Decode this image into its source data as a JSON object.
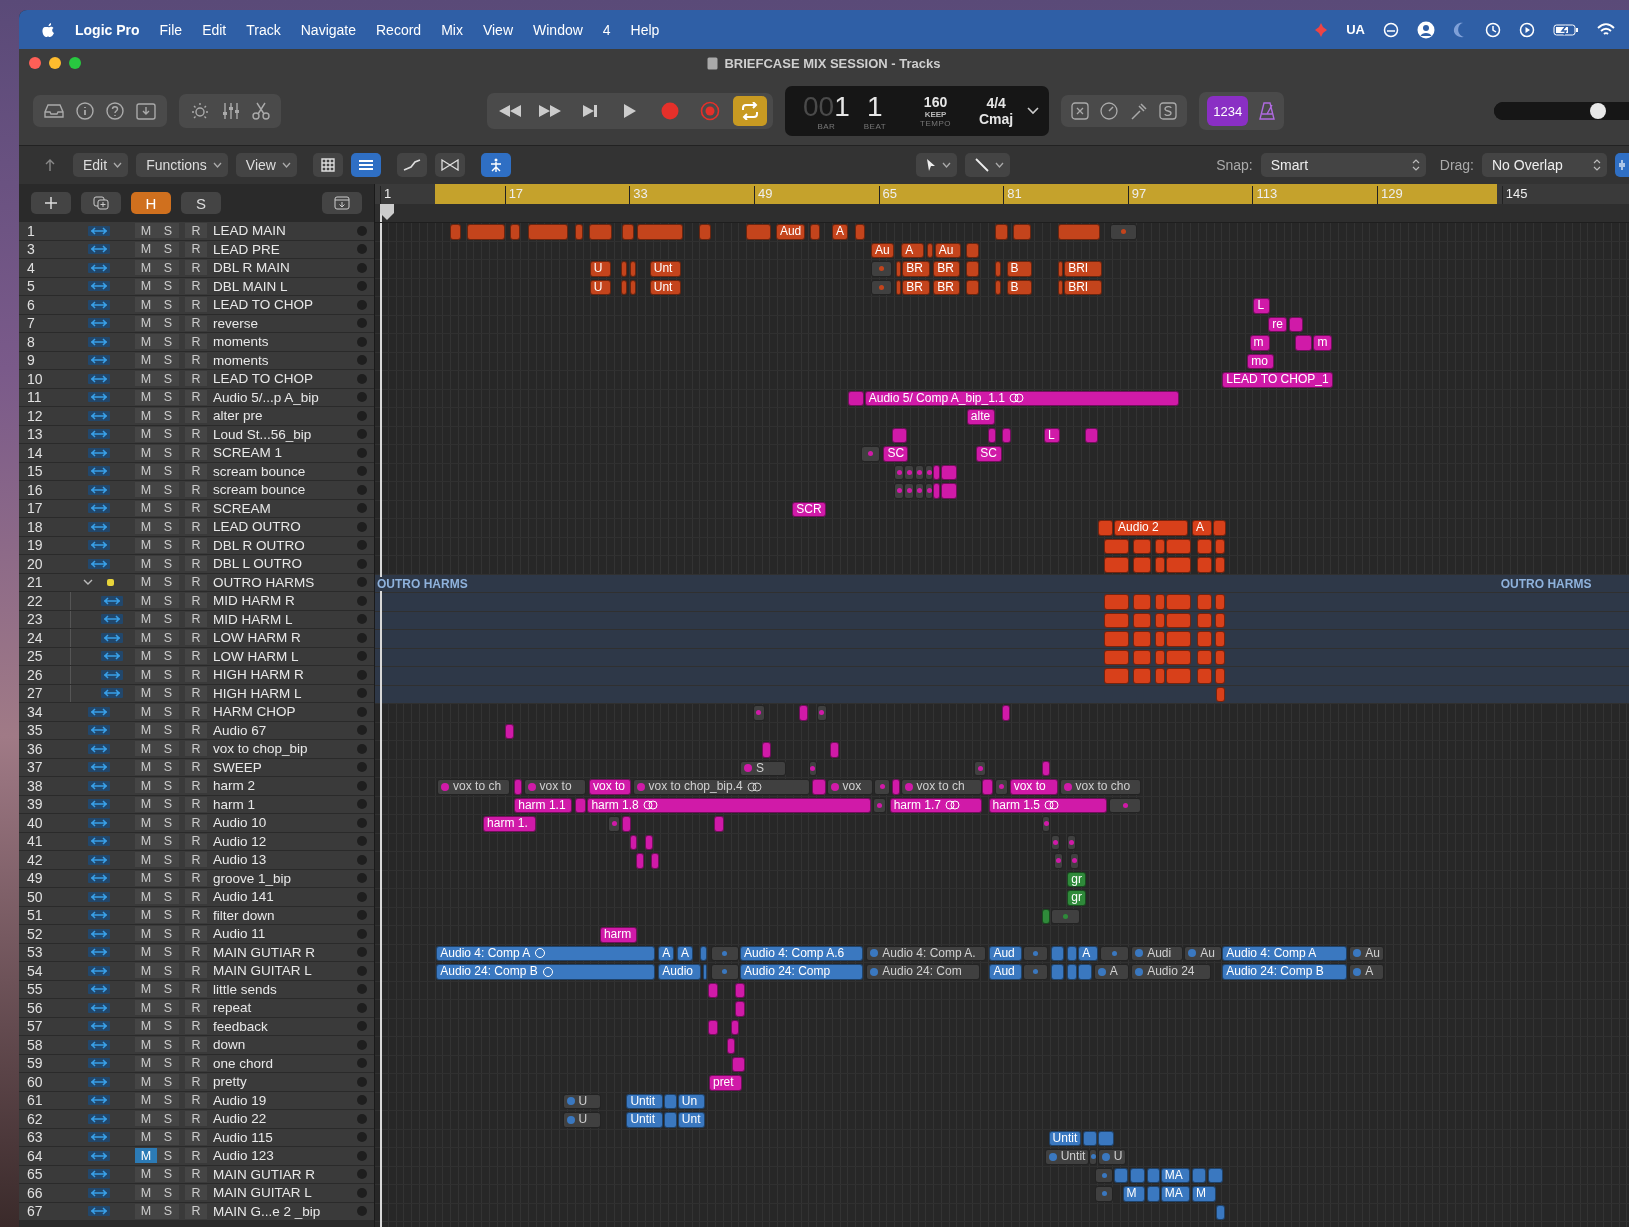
{
  "menu_bar": {
    "app_name": "Logic Pro",
    "items": [
      "File",
      "Edit",
      "Track",
      "Navigate",
      "Record",
      "Mix",
      "View",
      "Window",
      "4",
      "Help"
    ],
    "status_text": "UA"
  },
  "window": {
    "title": "BRIEFCASE MIX SESSION - Tracks"
  },
  "control_bar": {
    "cycle_on": true,
    "lcd": {
      "bar_prefix": "00",
      "bar": "1",
      "beat": "1",
      "bar_label": "BAR",
      "beat_label": "BEAT",
      "tempo": "160",
      "tempo_mode": "KEEP",
      "tempo_label": "TEMPO",
      "time_signature": "4/4",
      "key": "Cmaj"
    },
    "count_in": "1234",
    "master_volume": {
      "level": 0.72
    }
  },
  "tracks_toolbar": {
    "menus": [
      "Edit",
      "Functions",
      "View"
    ],
    "snap_label": "Snap:",
    "snap_value": "Smart",
    "drag_label": "Drag:",
    "drag_value": "No Overlap"
  },
  "track_header": {
    "buttons": [
      {
        "label": "H",
        "selected": true
      },
      {
        "label": "S",
        "selected": false
      }
    ]
  },
  "ruler": {
    "bars": [
      "1",
      "17",
      "33",
      "49",
      "65",
      "81",
      "97",
      "113",
      "129",
      "145"
    ]
  },
  "tracks": [
    {
      "number": "1",
      "name": "LEAD MAIN",
      "mute_label": "M",
      "mute": false,
      "solo_label": "S",
      "record_label": "R",
      "color": "#c4441c",
      "regions": [
        {
          "active": true
        },
        {
          "active": true
        },
        {
          "active": true
        },
        {
          "active": true
        },
        {
          "active": true
        },
        {
          "active": true
        },
        {
          "active": true
        },
        {
          "active": true
        },
        {
          "active": true
        },
        {
          "active": true
        },
        {
          "label": "Aud",
          "active": true
        },
        {
          "active": true
        },
        {
          "label": "A",
          "active": true
        },
        {
          "active": true
        },
        {
          "active": true
        },
        {
          "active": true
        },
        {
          "active": true
        },
        {
          "active": false
        }
      ]
    },
    {
      "number": "3",
      "name": "LEAD PRE",
      "mute_label": "M",
      "mute": false,
      "solo_label": "S",
      "record_label": "R",
      "color": "#c4441c",
      "regions": [
        {
          "label": "Au",
          "active": true
        },
        {
          "label": "A",
          "active": true
        },
        {
          "active": true
        },
        {
          "label": "Au",
          "active": true
        },
        {
          "active": true
        }
      ]
    },
    {
      "number": "4",
      "name": "DBL R MAIN",
      "mute_label": "M",
      "mute": false,
      "solo_label": "S",
      "record_label": "R",
      "color": "#c4441c",
      "regions": [
        {
          "label": "U",
          "active": true
        },
        {
          "active": true
        },
        {
          "active": true
        },
        {
          "label": "Unt",
          "active": true
        },
        {
          "active": false
        },
        {
          "active": true
        },
        {
          "label": "BR",
          "active": true
        },
        {
          "label": "BR",
          "active": true
        },
        {
          "active": true
        },
        {
          "active": true
        },
        {
          "label": "B",
          "active": true
        },
        {
          "active": true
        },
        {
          "label": "BRI",
          "active": true
        }
      ]
    },
    {
      "number": "5",
      "name": "DBL MAIN L",
      "mute_label": "M",
      "mute": false,
      "solo_label": "S",
      "record_label": "R",
      "color": "#c4441c",
      "regions": [
        {
          "label": "U",
          "active": true
        },
        {
          "active": true
        },
        {
          "active": true
        },
        {
          "label": "Unt",
          "active": true
        },
        {
          "active": false
        },
        {
          "active": true
        },
        {
          "label": "BR",
          "active": true
        },
        {
          "label": "BR",
          "active": true
        },
        {
          "active": true
        },
        {
          "active": true
        },
        {
          "label": "B",
          "active": true
        },
        {
          "active": true
        },
        {
          "label": "BRI",
          "active": true
        }
      ]
    },
    {
      "number": "6",
      "name": "LEAD TO CHOP",
      "mute_label": "M",
      "mute": false,
      "solo_label": "S",
      "record_label": "R",
      "color": "#d01aa8",
      "regions": [
        {
          "label": "L",
          "active": true
        }
      ]
    },
    {
      "number": "7",
      "name": "reverse",
      "mute_label": "M",
      "mute": false,
      "solo_label": "S",
      "record_label": "R",
      "color": "#d01aa8",
      "regions": [
        {
          "label": "re",
          "active": true
        },
        {
          "active": true
        }
      ]
    },
    {
      "number": "8",
      "name": "moments",
      "mute_label": "M",
      "mute": false,
      "solo_label": "S",
      "record_label": "R",
      "color": "#d01aa8",
      "regions": [
        {
          "label": "m",
          "active": true
        },
        {
          "active": true
        },
        {
          "label": "m",
          "active": true
        }
      ]
    },
    {
      "number": "9",
      "name": "moments",
      "mute_label": "M",
      "mute": false,
      "solo_label": "S",
      "record_label": "R",
      "color": "#d01aa8",
      "regions": [
        {
          "label": "mo",
          "active": true
        }
      ]
    },
    {
      "number": "10",
      "name": "LEAD TO CHOP",
      "mute_label": "M",
      "mute": false,
      "solo_label": "S",
      "record_label": "R",
      "color": "#d01aa8",
      "regions": [
        {
          "label": "LEAD TO CHOP_1",
          "active": true
        }
      ]
    },
    {
      "number": "11",
      "name": "Audio 5/...p A_bip",
      "mute_label": "M",
      "mute": false,
      "solo_label": "S",
      "record_label": "R",
      "color": "#d01aa8",
      "regions": [
        {
          "active": true
        },
        {
          "label": "Audio 5/ Comp A_bip_1.1",
          "kind": "comp",
          "active": true
        }
      ]
    },
    {
      "number": "12",
      "name": "alter pre",
      "mute_label": "M",
      "mute": false,
      "solo_label": "S",
      "record_label": "R",
      "color": "#d01aa8",
      "regions": [
        {
          "label": "alte",
          "active": true
        }
      ]
    },
    {
      "number": "13",
      "name": "Loud St...56_bip",
      "mute_label": "M",
      "mute": false,
      "solo_label": "S",
      "record_label": "R",
      "color": "#d01aa8",
      "regions": [
        {
          "active": true
        },
        {
          "active": true
        },
        {
          "active": true
        },
        {
          "label": "L",
          "active": true
        },
        {
          "active": true
        }
      ]
    },
    {
      "number": "14",
      "name": "SCREAM 1",
      "mute_label": "M",
      "mute": false,
      "solo_label": "S",
      "record_label": "R",
      "color": "#d01aa8",
      "regions": [
        {
          "active": false
        },
        {
          "label": "SC",
          "active": true
        },
        {
          "label": "SC",
          "active": true
        }
      ]
    },
    {
      "number": "15",
      "name": "scream bounce",
      "mute_label": "M",
      "mute": false,
      "solo_label": "S",
      "record_label": "R",
      "color": "#d01aa8",
      "regions": [
        {
          "active": false
        },
        {
          "active": false
        },
        {
          "active": false
        },
        {
          "active": false
        },
        {
          "active": true
        },
        {
          "active": true
        }
      ]
    },
    {
      "number": "16",
      "name": "scream bounce",
      "mute_label": "M",
      "mute": false,
      "solo_label": "S",
      "record_label": "R",
      "color": "#d01aa8",
      "regions": [
        {
          "active": false
        },
        {
          "active": false
        },
        {
          "active": false
        },
        {
          "active": false
        },
        {
          "active": true
        },
        {
          "active": true
        }
      ]
    },
    {
      "number": "17",
      "name": "SCREAM",
      "mute_label": "M",
      "mute": false,
      "solo_label": "S",
      "record_label": "R",
      "color": "#d01aa8",
      "regions": [
        {
          "label": "SCR",
          "active": true
        }
      ]
    },
    {
      "number": "18",
      "name": "LEAD OUTRO",
      "mute_label": "M",
      "mute": false,
      "solo_label": "S",
      "record_label": "R",
      "color": "#d8401a",
      "regions": [
        {
          "active": true
        },
        {
          "label": "Audio 2",
          "active": true
        },
        {
          "label": "A",
          "active": true
        },
        {
          "active": true
        }
      ]
    },
    {
      "number": "19",
      "name": "DBL R OUTRO",
      "mute_label": "M",
      "mute": false,
      "solo_label": "S",
      "record_label": "R",
      "color": "#d8401a",
      "regions": [
        {
          "active": true
        },
        {
          "active": true
        },
        {
          "active": true
        },
        {
          "active": true
        },
        {
          "active": true
        },
        {
          "active": true
        }
      ]
    },
    {
      "number": "20",
      "name": "DBL L OUTRO",
      "mute_label": "M",
      "mute": false,
      "solo_label": "S",
      "record_label": "R",
      "color": "#d8401a",
      "regions": [
        {
          "active": true
        },
        {
          "active": true
        },
        {
          "active": true
        },
        {
          "active": true
        },
        {
          "active": true
        },
        {
          "active": true
        }
      ]
    },
    {
      "number": "21",
      "name": "OUTRO HARMS",
      "mute_label": "M",
      "mute": false,
      "solo_label": "S",
      "record_label": "R",
      "kind": "folder",
      "expanded": true,
      "color": "#e8d43a",
      "folder_labels": [
        "OUTRO HARMS",
        "OUTRO HARMS"
      ],
      "children": [
        {
          "number": "22",
          "name": "MID HARM R",
          "mute_label": "M",
          "mute": false,
          "solo_label": "S",
          "record_label": "R",
          "color": "#d8401a",
          "regions": [
            {
              "active": true
            },
            {
              "active": true
            },
            {
              "active": true
            },
            {
              "active": true
            },
            {
              "active": true
            },
            {
              "active": true
            }
          ]
        },
        {
          "number": "23",
          "name": "MID HARM L",
          "mute_label": "M",
          "mute": false,
          "solo_label": "S",
          "record_label": "R",
          "color": "#d8401a",
          "regions": [
            {
              "active": true
            },
            {
              "active": true
            },
            {
              "active": true
            },
            {
              "active": true
            },
            {
              "active": true
            },
            {
              "active": true
            }
          ]
        },
        {
          "number": "24",
          "name": "LOW HARM R",
          "mute_label": "M",
          "mute": false,
          "solo_label": "S",
          "record_label": "R",
          "color": "#d8401a",
          "regions": [
            {
              "active": true
            },
            {
              "active": true
            },
            {
              "active": true
            },
            {
              "active": true
            },
            {
              "active": true
            },
            {
              "active": true
            }
          ]
        },
        {
          "number": "25",
          "name": "LOW HARM L",
          "mute_label": "M",
          "mute": false,
          "solo_label": "S",
          "record_label": "R",
          "color": "#d8401a",
          "regions": [
            {
              "active": true
            },
            {
              "active": true
            },
            {
              "active": true
            },
            {
              "active": true
            },
            {
              "active": true
            },
            {
              "active": true
            }
          ]
        },
        {
          "number": "26",
          "name": "HIGH HARM R",
          "mute_label": "M",
          "mute": false,
          "solo_label": "S",
          "record_label": "R",
          "color": "#d8401a",
          "regions": [
            {
              "active": true
            },
            {
              "active": true
            },
            {
              "active": true
            },
            {
              "active": true
            },
            {
              "active": true
            },
            {
              "active": true
            }
          ]
        },
        {
          "number": "27",
          "name": "HIGH HARM L",
          "mute_label": "M",
          "mute": false,
          "solo_label": "S",
          "record_label": "R",
          "color": "#d8401a",
          "regions": [
            {
              "active": true
            }
          ]
        }
      ]
    },
    {
      "number": "34",
      "name": "HARM CHOP",
      "mute_label": "M",
      "mute": false,
      "solo_label": "S",
      "record_label": "R",
      "color": "#d01aa8",
      "regions": [
        {
          "active": false
        },
        {
          "active": true
        },
        {
          "active": false
        },
        {
          "active": true
        }
      ]
    },
    {
      "number": "35",
      "name": "Audio 67",
      "mute_label": "M",
      "mute": false,
      "solo_label": "S",
      "record_label": "R",
      "color": "#d01aa8",
      "regions": [
        {
          "active": true
        }
      ]
    },
    {
      "number": "36",
      "name": "vox to chop_bip",
      "mute_label": "M",
      "mute": false,
      "solo_label": "S",
      "record_label": "R",
      "color": "#d01aa8",
      "regions": [
        {
          "active": true
        },
        {
          "active": true
        }
      ]
    },
    {
      "number": "37",
      "name": "SWEEP",
      "mute_label": "M",
      "mute": false,
      "solo_label": "S",
      "record_label": "R",
      "color": "#d01aa8",
      "regions": [
        {
          "label": "S",
          "active": false
        },
        {
          "active": false
        },
        {
          "active": false
        },
        {
          "active": true
        }
      ]
    },
    {
      "number": "38",
      "name": "harm 2",
      "mute_label": "M",
      "mute": false,
      "solo_label": "S",
      "record_label": "R",
      "color": "#d01aa8",
      "regions": [
        {
          "label": "vox to ch",
          "active": false
        },
        {
          "active": true
        },
        {
          "label": "vox to",
          "active": false
        },
        {
          "label": "vox to",
          "active": true
        },
        {
          "label": "vox to chop_bip.4",
          "kind": "comp",
          "active": false
        },
        {
          "active": true
        },
        {
          "label": "vox",
          "active": false
        },
        {
          "active": false
        },
        {
          "active": true
        },
        {
          "label": "vox to ch",
          "active": false
        },
        {
          "active": true
        },
        {
          "active": false
        },
        {
          "label": "vox to",
          "active": true
        },
        {
          "label": "vox to cho",
          "active": false
        }
      ]
    },
    {
      "number": "39",
      "name": "harm 1",
      "mute_label": "M",
      "mute": false,
      "solo_label": "S",
      "record_label": "R",
      "color": "#d01aa8",
      "regions": [
        {
          "label": "harm 1.1",
          "active": true
        },
        {
          "active": true
        },
        {
          "label": "harm 1.8",
          "kind": "comp",
          "active": true
        },
        {
          "active": false
        },
        {
          "label": "harm 1.7",
          "kind": "comp",
          "active": true
        },
        {
          "label": "harm 1.5",
          "kind": "comp",
          "active": true
        },
        {
          "active": false
        }
      ]
    },
    {
      "number": "40",
      "name": "Audio 10",
      "mute_label": "M",
      "mute": false,
      "solo_label": "S",
      "record_label": "R",
      "color": "#d01aa8",
      "regions": [
        {
          "label": "harm 1.",
          "active": true
        },
        {
          "active": false
        },
        {
          "active": true
        },
        {
          "active": true
        },
        {
          "active": false
        }
      ]
    },
    {
      "number": "41",
      "name": "Audio 12",
      "mute_label": "M",
      "mute": false,
      "solo_label": "S",
      "record_label": "R",
      "color": "#d01aa8",
      "regions": [
        {
          "active": true
        },
        {
          "active": true
        },
        {
          "active": false
        },
        {
          "active": false
        }
      ]
    },
    {
      "number": "42",
      "name": "Audio 13",
      "mute_label": "M",
      "mute": false,
      "solo_label": "S",
      "record_label": "R",
      "color": "#d01aa8",
      "regions": [
        {
          "active": true
        },
        {
          "active": true
        },
        {
          "active": false
        },
        {
          "active": false
        }
      ]
    },
    {
      "number": "49",
      "name": "groove 1_bip",
      "mute_label": "M",
      "mute": false,
      "solo_label": "S",
      "record_label": "R",
      "color": "#2f8a3a",
      "regions": [
        {
          "label": "gr",
          "active": true
        }
      ]
    },
    {
      "number": "50",
      "name": "Audio 141",
      "mute_label": "M",
      "mute": false,
      "solo_label": "S",
      "record_label": "R",
      "color": "#2f8a3a",
      "regions": [
        {
          "label": "gr",
          "active": true
        }
      ]
    },
    {
      "number": "51",
      "name": "filter down",
      "mute_label": "M",
      "mute": false,
      "solo_label": "S",
      "record_label": "R",
      "color": "#2f8a3a",
      "regions": [
        {
          "active": true
        },
        {
          "active": false
        }
      ]
    },
    {
      "number": "52",
      "name": "Audio 11",
      "mute_label": "M",
      "mute": false,
      "solo_label": "S",
      "record_label": "R",
      "color": "#d01aa8",
      "regions": [
        {
          "label": "harm",
          "active": true
        }
      ]
    },
    {
      "number": "53",
      "name": "MAIN GUTIAR R",
      "mute_label": "M",
      "mute": false,
      "solo_label": "S",
      "record_label": "R",
      "color": "#3a78c0",
      "regions": [
        {
          "label": "Audio 4: Comp A",
          "kind": "take",
          "active": true
        },
        {
          "label": "A",
          "active": true
        },
        {
          "label": "A",
          "active": true
        },
        {
          "active": true
        },
        {
          "active": false
        },
        {
          "label": "Audio 4: Comp A.6",
          "active": true
        },
        {
          "label": "Audio 4: Comp A.",
          "active": false
        },
        {
          "label": "Aud",
          "active": true
        },
        {
          "active": false
        },
        {
          "active": true
        },
        {
          "active": true
        },
        {
          "label": "A",
          "active": true
        },
        {
          "active": false
        },
        {
          "label": "Audi",
          "active": false
        },
        {
          "label": "Au",
          "active": false
        },
        {
          "label": "Audio 4: Comp A",
          "active": true
        },
        {
          "label": "Au",
          "active": false
        }
      ]
    },
    {
      "number": "54",
      "name": "MAIN GUITAR L",
      "mute_label": "M",
      "mute": false,
      "solo_label": "S",
      "record_label": "R",
      "color": "#3a78c0",
      "regions": [
        {
          "label": "Audio 24: Comp B",
          "kind": "take",
          "active": true
        },
        {
          "label": "Audio",
          "active": true
        },
        {
          "active": true
        },
        {
          "active": false
        },
        {
          "label": "Audio 24: Comp",
          "active": true
        },
        {
          "label": "Audio 24: Com",
          "active": false
        },
        {
          "label": "Aud",
          "active": true
        },
        {
          "active": false
        },
        {
          "active": true
        },
        {
          "active": true
        },
        {
          "active": true
        },
        {
          "label": "A",
          "active": false
        },
        {
          "label": "Audio 24",
          "active": false
        },
        {
          "label": "Audio 24: Comp B",
          "active": true
        },
        {
          "label": "A",
          "active": false
        }
      ]
    },
    {
      "number": "55",
      "name": "little sends",
      "mute_label": "M",
      "mute": false,
      "solo_label": "S",
      "record_label": "R",
      "color": "#d01aa8",
      "regions": [
        {
          "active": true
        },
        {
          "active": true
        }
      ]
    },
    {
      "number": "56",
      "name": "repeat",
      "mute_label": "M",
      "mute": false,
      "solo_label": "S",
      "record_label": "R",
      "color": "#d01aa8",
      "regions": [
        {
          "active": true
        }
      ]
    },
    {
      "number": "57",
      "name": "feedback",
      "mute_label": "M",
      "mute": false,
      "solo_label": "S",
      "record_label": "R",
      "color": "#d01aa8",
      "regions": [
        {
          "active": true
        },
        {
          "active": true
        }
      ]
    },
    {
      "number": "58",
      "name": "down",
      "mute_label": "M",
      "mute": false,
      "solo_label": "S",
      "record_label": "R",
      "color": "#d01aa8",
      "regions": [
        {
          "active": true
        }
      ]
    },
    {
      "number": "59",
      "name": "one chord",
      "mute_label": "M",
      "mute": false,
      "solo_label": "S",
      "record_label": "R",
      "color": "#d01aa8",
      "regions": [
        {
          "active": true
        }
      ]
    },
    {
      "number": "60",
      "name": "pretty",
      "mute_label": "M",
      "mute": false,
      "solo_label": "S",
      "record_label": "R",
      "color": "#d01aa8",
      "regions": [
        {
          "label": "pret",
          "active": true
        }
      ]
    },
    {
      "number": "61",
      "name": "Audio 19",
      "mute_label": "M",
      "mute": false,
      "solo_label": "S",
      "record_label": "R",
      "color": "#3a78c0",
      "regions": [
        {
          "label": "U",
          "active": false
        },
        {
          "label": "Untit",
          "active": true
        },
        {
          "active": true
        },
        {
          "label": "Un",
          "active": true
        }
      ]
    },
    {
      "number": "62",
      "name": "Audio 22",
      "mute_label": "M",
      "mute": false,
      "solo_label": "S",
      "record_label": "R",
      "color": "#3a78c0",
      "regions": [
        {
          "label": "U",
          "active": false
        },
        {
          "label": "Untit",
          "active": true
        },
        {
          "active": true
        },
        {
          "label": "Unt",
          "active": true
        }
      ]
    },
    {
      "number": "63",
      "name": "Audio 115",
      "mute_label": "M",
      "mute": false,
      "solo_label": "S",
      "record_label": "R",
      "color": "#3a78c0",
      "regions": [
        {
          "label": "Untit",
          "active": true
        },
        {
          "active": true
        },
        {
          "active": true
        }
      ]
    },
    {
      "number": "64",
      "name": "Audio 123",
      "mute_label": "M",
      "mute": true,
      "solo_label": "S",
      "record_label": "R",
      "color": "#3a78c0",
      "regions": [
        {
          "label": "Untit",
          "active": false
        },
        {
          "active": false
        },
        {
          "label": "U",
          "active": false
        }
      ]
    },
    {
      "number": "65",
      "name": "MAIN GUTIAR R",
      "mute_label": "M",
      "mute": false,
      "solo_label": "S",
      "record_label": "R",
      "color": "#3a78c0",
      "regions": [
        {
          "active": false
        },
        {
          "active": true
        },
        {
          "active": true
        },
        {
          "active": true
        },
        {
          "label": "MA",
          "active": true
        },
        {
          "active": true
        },
        {
          "active": true
        }
      ]
    },
    {
      "number": "66",
      "name": "MAIN GUITAR L",
      "mute_label": "M",
      "mute": false,
      "solo_label": "S",
      "record_label": "R",
      "color": "#3a78c0",
      "regions": [
        {
          "active": false
        },
        {
          "label": "M",
          "active": true
        },
        {
          "active": true
        },
        {
          "label": "MA",
          "active": true
        },
        {
          "label": "M",
          "active": true
        }
      ]
    },
    {
      "number": "67",
      "name": "MAIN G...e 2 _bip",
      "mute_label": "M",
      "mute": false,
      "solo_label": "S",
      "record_label": "R",
      "color": "#3a78c0",
      "regions": [
        {
          "active": true
        }
      ]
    }
  ]
}
